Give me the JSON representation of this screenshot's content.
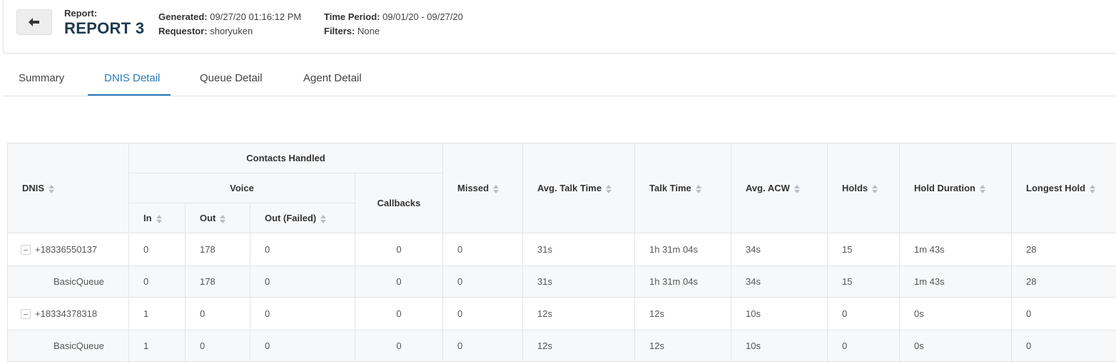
{
  "header": {
    "back_icon": "arrow-left-icon",
    "report_label": "Report:",
    "report_name": "REPORT 3",
    "generated_label": "Generated:",
    "generated_value": "09/27/20 01:16:12 PM",
    "requestor_label": "Requestor:",
    "requestor_value": "shoryuken",
    "time_period_label": "Time Period:",
    "time_period_value": "09/01/20 - 09/27/20",
    "filters_label": "Filters:",
    "filters_value": "None"
  },
  "tabs": [
    {
      "label": "Summary"
    },
    {
      "label": "DNIS Detail"
    },
    {
      "label": "Queue Detail"
    },
    {
      "label": "Agent Detail"
    }
  ],
  "active_tab": "DNIS Detail",
  "accent_color": "#2a7ab8",
  "table": {
    "headers": {
      "dnis": "DNIS",
      "contacts_handled": "Contacts Handled",
      "voice": "Voice",
      "callbacks": "Callbacks",
      "in": "In",
      "out": "Out",
      "out_failed": "Out (Failed)",
      "missed": "Missed",
      "avg_talk_time": "Avg. Talk Time",
      "talk_time": "Talk Time",
      "avg_acw": "Avg. ACW",
      "holds": "Holds",
      "hold_duration": "Hold Duration",
      "longest_hold": "Longest Hold"
    },
    "rows": [
      {
        "name": "+18336550137",
        "in": "0",
        "out": "178",
        "out_failed": "0",
        "callbacks": "0",
        "missed": "0",
        "avg_talk_time": "31s",
        "talk_time": "1h 31m 04s",
        "avg_acw": "34s",
        "holds": "15",
        "hold_duration": "1m 43s",
        "longest_hold": "28"
      },
      {
        "name": "BasicQueue",
        "in": "0",
        "out": "178",
        "out_failed": "0",
        "callbacks": "0",
        "missed": "0",
        "avg_talk_time": "31s",
        "talk_time": "1h 31m 04s",
        "avg_acw": "34s",
        "holds": "15",
        "hold_duration": "1m 43s",
        "longest_hold": "28"
      },
      {
        "name": "+18334378318",
        "in": "1",
        "out": "0",
        "out_failed": "0",
        "callbacks": "0",
        "missed": "0",
        "avg_talk_time": "12s",
        "talk_time": "12s",
        "avg_acw": "10s",
        "holds": "0",
        "hold_duration": "0s",
        "longest_hold": "0"
      },
      {
        "name": "BasicQueue",
        "in": "1",
        "out": "0",
        "out_failed": "0",
        "callbacks": "0",
        "missed": "0",
        "avg_talk_time": "12s",
        "talk_time": "12s",
        "avg_acw": "10s",
        "holds": "0",
        "hold_duration": "0s",
        "longest_hold": "0"
      }
    ]
  }
}
